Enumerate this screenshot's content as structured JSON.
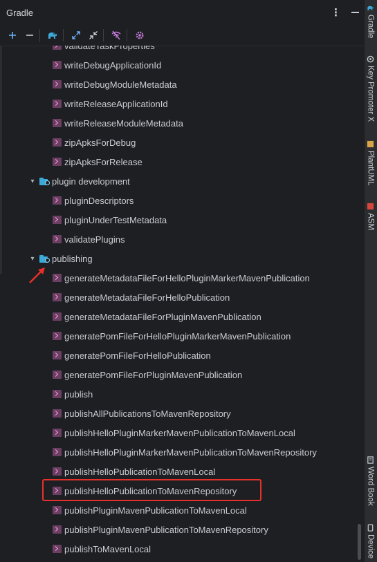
{
  "panel": {
    "title": "Gradle"
  },
  "colors": {
    "background": "#1e1f22",
    "highlight": "#e8302b",
    "task_icon": "#6b3f64",
    "folder_icon": "#3da9d8"
  },
  "toolbar": {
    "icons": [
      "add-icon",
      "remove-icon",
      "gradle-elephant-icon",
      "expand-all-icon",
      "collapse-all-icon",
      "offline-mode-icon",
      "settings-icon"
    ]
  },
  "tree": {
    "top_tasks": [
      "validateTaskProperties",
      "writeDebugApplicationId",
      "writeDebugModuleMetadata",
      "writeReleaseApplicationId",
      "writeReleaseModuleMetadata",
      "zipApksForDebug",
      "zipApksForRelease"
    ],
    "plugin_development": {
      "label": "plugin development",
      "tasks": [
        "pluginDescriptors",
        "pluginUnderTestMetadata",
        "validatePlugins"
      ]
    },
    "publishing": {
      "label": "publishing",
      "tasks": [
        "generateMetadataFileForHelloPluginMarkerMavenPublication",
        "generateMetadataFileForHelloPublication",
        "generateMetadataFileForPluginMavenPublication",
        "generatePomFileForHelloPluginMarkerMavenPublication",
        "generatePomFileForHelloPublication",
        "generatePomFileForPluginMavenPublication",
        "publish",
        "publishAllPublicationsToMavenRepository",
        "publishHelloPluginMarkerMavenPublicationToMavenLocal",
        "publishHelloPluginMarkerMavenPublicationToMavenRepository",
        "publishHelloPublicationToMavenLocal",
        "publishHelloPublicationToMavenRepository",
        "publishPluginMavenPublicationToMavenLocal",
        "publishPluginMavenPublicationToMavenRepository",
        "publishToMavenLocal"
      ]
    }
  },
  "right_tabs": {
    "gradle": "Gradle",
    "key_promoter": "Key Promoter X",
    "plantuml": "PlantUML",
    "asm": "ASM",
    "word_book": "Word Book",
    "device": "Device"
  }
}
